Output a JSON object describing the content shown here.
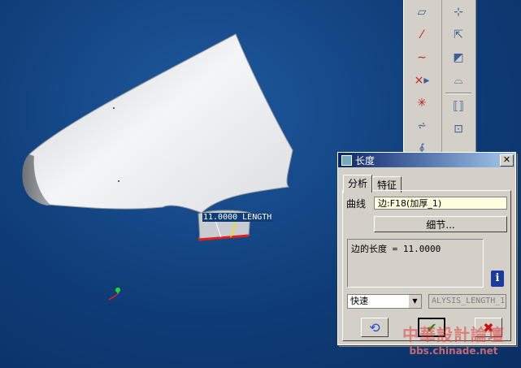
{
  "viewport": {
    "dimension_label": "11.0000 LENGTH"
  },
  "toolbar": {
    "left_icons": [
      "plane-icon",
      "axis-icon",
      "curve-icon",
      "point-icon",
      "csys-icon",
      "analysis-feature-icon",
      "sketch-icon"
    ],
    "right_icons": [
      "view-orient-icon",
      "spin-icon",
      "surface-icon",
      "boundary-icon",
      "offset-icon",
      "section-icon"
    ]
  },
  "dialog": {
    "title": "长度",
    "close": "✕",
    "tabs": [
      "分析",
      "特征"
    ],
    "curve_label": "曲线",
    "curve_value": "边:F18(加厚_1)",
    "detail_button": "细节...",
    "result": "边的长度 = 11.0000",
    "info": "i",
    "mode": "快速",
    "param_name": "ALYSIS_LENGTH_1",
    "buttons": {
      "repeat": "repeat-icon",
      "ok": "checkmark-icon",
      "cancel": "cancel-x-icon"
    }
  },
  "watermark": {
    "title": "中華設計論壇",
    "url": "bbs.chinade.net"
  },
  "colors": {
    "background": "#0f3d78",
    "dialog": "#d4d0c8",
    "titlebar": "#0a246a",
    "highlight_edge": "#e02020"
  }
}
